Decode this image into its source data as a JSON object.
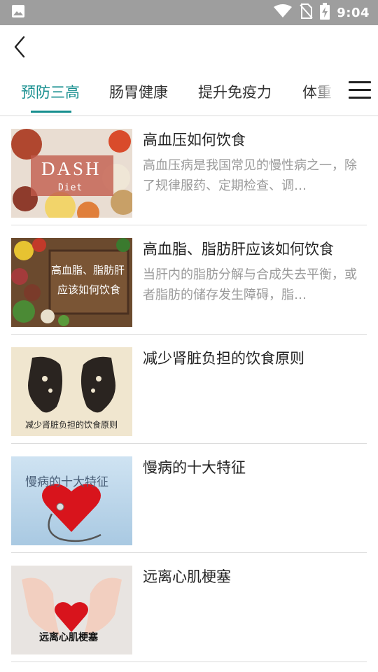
{
  "status_bar": {
    "time": "9:04",
    "icons": [
      "image-icon",
      "wifi-icon",
      "no-sim-icon",
      "battery-charging-icon"
    ]
  },
  "nav": {
    "back_icon": "chevron-left-icon",
    "menu_icon": "hamburger-menu-icon"
  },
  "tabs": [
    {
      "label": "预防三高",
      "active": true
    },
    {
      "label": "肠胃健康",
      "active": false
    },
    {
      "label": "提升免疫力",
      "active": false
    },
    {
      "label": "体重",
      "active": false
    }
  ],
  "articles": [
    {
      "title": "高血压如何饮食",
      "description": "高血压病是我国常见的慢性病之一，除了规律服药、定期检查、调…",
      "thumb_text": [
        "DASH",
        "Diet"
      ]
    },
    {
      "title": "高血脂、脂肪肝应该如何饮食",
      "description": "当肝内的脂肪分解与合成失去平衡，或者脂肪的储存发生障碍，脂…",
      "thumb_text": [
        "高血脂、脂肪肝",
        "应该如何饮食"
      ]
    },
    {
      "title": "减少肾脏负担的饮食原则",
      "description": "",
      "thumb_text": [
        "减少肾脏负担的饮食原则"
      ]
    },
    {
      "title": "慢病的十大特征",
      "description": "",
      "thumb_text": [
        "慢病的十大特征"
      ]
    },
    {
      "title": "远离心肌梗塞",
      "description": "",
      "thumb_text": [
        "远离心肌梗塞"
      ]
    }
  ],
  "colors": {
    "accent": "#178f8f",
    "status_bar": "#9e9e9e",
    "divider": "#dcdcdc",
    "desc_text": "#9a9a9a"
  }
}
